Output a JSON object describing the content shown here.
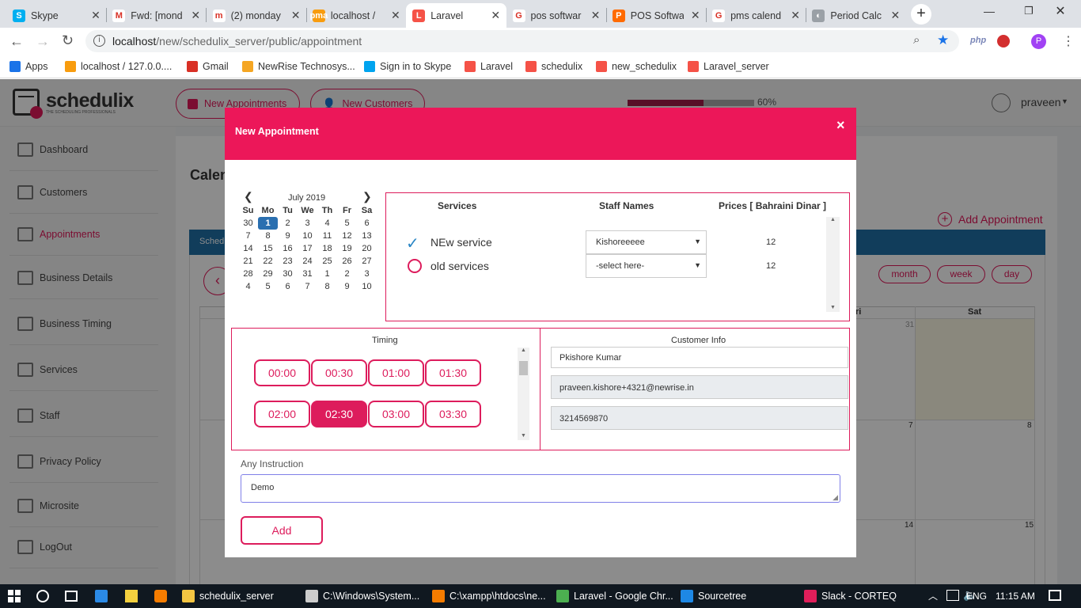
{
  "browser": {
    "tabs": [
      {
        "title": "Skype",
        "fav_color": "#00aff0",
        "fav": "S"
      },
      {
        "title": "Fwd: [mond",
        "fav_color": "#ffffff",
        "fav": "M"
      },
      {
        "title": "(2) monday",
        "fav_color": "#ffffff",
        "fav": "m"
      },
      {
        "title": "localhost /",
        "fav_color": "#f89c0e",
        "fav": "pma"
      },
      {
        "title": "Laravel",
        "fav_color": "#f55247",
        "fav": "L"
      },
      {
        "title": "pos softwar",
        "fav_color": "#ffffff",
        "fav": "G"
      },
      {
        "title": "POS Softwa",
        "fav_color": "#ff6a00",
        "fav": "P"
      },
      {
        "title": "pms calend",
        "fav_color": "#ffffff",
        "fav": "G"
      },
      {
        "title": "Period Calc",
        "fav_color": "#9aa0a6",
        "fav": "◐"
      }
    ],
    "url_host": "localhost",
    "url_path": "/new/schedulix_server/public/appointment",
    "bookmarks": [
      {
        "label": "Apps",
        "color": "#1a73e8"
      },
      {
        "label": "localhost / 127.0.0....",
        "color": "#f89c0e"
      },
      {
        "label": "Gmail",
        "color": "#d93025"
      },
      {
        "label": "NewRise Technosys...",
        "color": "#f5a623"
      },
      {
        "label": "Sign in to Skype",
        "color": "#00a4ef"
      },
      {
        "label": "Laravel",
        "color": "#f55247"
      },
      {
        "label": "schedulix",
        "color": "#f55247"
      },
      {
        "label": "new_schedulix",
        "color": "#f55247"
      },
      {
        "label": "Laravel_server",
        "color": "#f55247"
      }
    ],
    "ext_php": "php",
    "profile_initial": "P"
  },
  "app": {
    "logo": "schedulix",
    "logo_tag": "THE SCHEDULING PROFESSIONALS",
    "new_appointments": "New Appointments",
    "new_customers": "New Customers",
    "progress_label": "60%",
    "progress": 0.6,
    "user": "praveen",
    "page_title": "Calen",
    "add_appointment": "Add Appointment",
    "view_month": "month",
    "view_week": "week",
    "view_day": "day",
    "cal_header_partial": "Sched",
    "cal_fri": "ri",
    "cal_sat": "Sat",
    "cal_nums": [
      "31",
      "7",
      "8",
      "14",
      "15"
    ]
  },
  "sidebar": [
    {
      "label": "Dashboard"
    },
    {
      "label": "Customers"
    },
    {
      "label": "Appointments"
    },
    {
      "label": "Business Details"
    },
    {
      "label": "Business Timing"
    },
    {
      "label": "Services"
    },
    {
      "label": "Staff"
    },
    {
      "label": "Privacy Policy"
    },
    {
      "label": "Microsite"
    },
    {
      "label": "LogOut"
    }
  ],
  "modal": {
    "title": "New Appointment",
    "close": "×",
    "mini_cal": {
      "month": "July 2019",
      "weekdays": [
        "Su",
        "Mo",
        "Tu",
        "We",
        "Th",
        "Fr",
        "Sa"
      ],
      "weeks": [
        [
          "30",
          "1",
          "2",
          "3",
          "4",
          "5",
          "6"
        ],
        [
          "7",
          "8",
          "9",
          "10",
          "11",
          "12",
          "13"
        ],
        [
          "14",
          "15",
          "16",
          "17",
          "18",
          "19",
          "20"
        ],
        [
          "21",
          "22",
          "23",
          "24",
          "25",
          "26",
          "27"
        ],
        [
          "28",
          "29",
          "30",
          "31",
          "1",
          "2",
          "3"
        ],
        [
          "4",
          "5",
          "6",
          "7",
          "8",
          "9",
          "10"
        ]
      ],
      "selected": "1"
    },
    "services_header": "Services",
    "staff_header": "Staff Names",
    "price_header": "Prices [ Bahraini Dinar ]",
    "services": [
      {
        "name": "NEw service",
        "staff": "Kishoreeeee",
        "price": "12",
        "checked": true
      },
      {
        "name": "old services",
        "staff": "-select here-",
        "price": "12",
        "checked": false
      }
    ],
    "timing_label": "Timing",
    "times": [
      "00:00",
      "00:30",
      "01:00",
      "01:30",
      "02:00",
      "02:30",
      "03:00",
      "03:30"
    ],
    "selected_time": "02:30",
    "customer_label": "Customer Info",
    "customer_name": "Pkishore Kumar",
    "customer_email": "praveen.kishore+4321@newrise.in",
    "customer_phone": "3214569870",
    "instruction_label": "Any Instruction",
    "instruction_value": "Demo",
    "add_button": "Add"
  },
  "taskbar": {
    "items": [
      {
        "label": "schedulix_server",
        "color": "#f4c542"
      },
      {
        "label": "C:\\Windows\\System...",
        "color": "#cccccc"
      },
      {
        "label": "C:\\xampp\\htdocs\\ne...",
        "color": "#f57c00"
      },
      {
        "label": "Laravel - Google Chr...",
        "color": "#4caf50"
      },
      {
        "label": "Sourcetree",
        "color": "#1e88e5"
      },
      {
        "label": "Slack - CORTEQ",
        "color": "#e01e5a"
      }
    ],
    "lang": "ENG",
    "time": "11:15 AM"
  }
}
